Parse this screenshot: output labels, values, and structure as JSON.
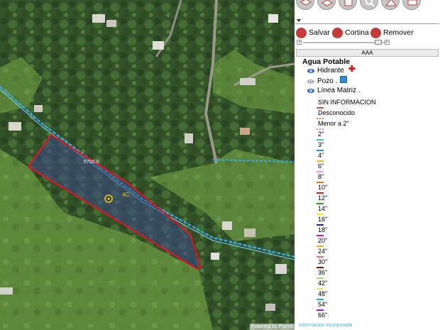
{
  "map": {
    "credit": "Powered by Puerto R",
    "parcel_label": "5700.0",
    "parcel_label_short": "4C"
  },
  "panel": {
    "toolbar": [
      {
        "name": "layers-stack-icon"
      },
      {
        "name": "layers-icon"
      },
      {
        "name": "print-preview-icon"
      },
      {
        "name": "search-icon"
      },
      {
        "name": "measure-icon"
      },
      {
        "name": "printer-icon"
      }
    ],
    "actions": {
      "save": "Salvar",
      "curtain": "Cortina",
      "remove": "Remover"
    },
    "group_bar": "AAA",
    "group_title": "Agua Potable",
    "layers": [
      {
        "label": "Hidrante",
        "visible": true
      },
      {
        "label": "Pozo .",
        "visible": false
      },
      {
        "label": "Línea Matriz .",
        "visible": true
      }
    ],
    "legend": [
      {
        "label": "SIN INFORMACION",
        "color": "#ffffff",
        "style": "solid"
      },
      {
        "label": "Desconocido",
        "color": "#b05050",
        "style": "solid"
      },
      {
        "label": "Menor a 2\"",
        "color": "#e07a5f",
        "style": "dotted"
      },
      {
        "label": "2\"",
        "color": "#d888d8",
        "style": "dotted"
      },
      {
        "label": "3\"",
        "color": "#3cc6b0",
        "style": "solid"
      },
      {
        "label": "4\"",
        "color": "#2f8be0",
        "style": "solid"
      },
      {
        "label": "6\"",
        "color": "#f2b233",
        "style": "solid"
      },
      {
        "label": "8\"",
        "color": "#f29ad0",
        "style": "solid"
      },
      {
        "label": "10\"",
        "color": "#e07820",
        "style": "solid"
      },
      {
        "label": "12\"",
        "color": "#e01010",
        "style": "solid"
      },
      {
        "label": "14\"",
        "color": "#3a8f2a",
        "style": "solid"
      },
      {
        "label": "16\"",
        "color": "#f0f000",
        "style": "solid"
      },
      {
        "label": "18\"",
        "color": "#2020a0",
        "style": "solid"
      },
      {
        "label": "20\"",
        "color": "#e010b0",
        "style": "solid"
      },
      {
        "label": "24\"",
        "color": "#e0b020",
        "style": "solid"
      },
      {
        "label": "30\"",
        "color": "#e07070",
        "style": "solid"
      },
      {
        "label": "36\"",
        "color": "#602000",
        "style": "solid"
      },
      {
        "label": "42\"",
        "color": "#a0e070",
        "style": "solid"
      },
      {
        "label": "48\"",
        "color": "#f0e060",
        "style": "solid"
      },
      {
        "label": "54\"",
        "color": "#10b0e0",
        "style": "solid"
      },
      {
        "label": "66\"",
        "color": "#b010e0",
        "style": "solid"
      }
    ],
    "footer": "Información incorporada"
  },
  "colors": {
    "parcel_outline": "#e0141e",
    "parcel_fill": "#3a4a8a",
    "pipe": "#39a8e6",
    "toolbar_icon": "#c53a3a"
  }
}
